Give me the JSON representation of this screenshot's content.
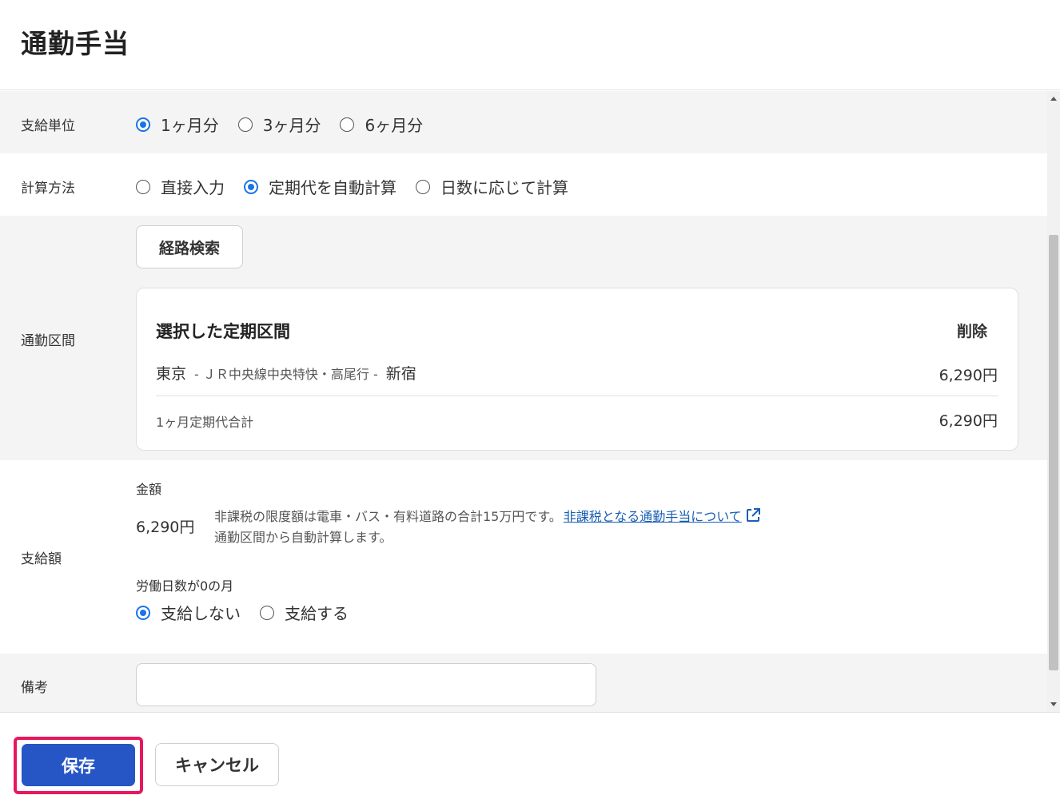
{
  "page": {
    "title": "通勤手当"
  },
  "payment_unit": {
    "label": "支給単位",
    "options": [
      {
        "label": "1ヶ月分",
        "selected": true
      },
      {
        "label": "3ヶ月分",
        "selected": false
      },
      {
        "label": "6ヶ月分",
        "selected": false
      }
    ]
  },
  "calc_method": {
    "label": "計算方法",
    "options": [
      {
        "label": "直接入力",
        "selected": false
      },
      {
        "label": "定期代を自動計算",
        "selected": true
      },
      {
        "label": "日数に応じて計算",
        "selected": false
      }
    ]
  },
  "commute_section": {
    "label": "通勤区間",
    "route_search_button": "経路検索",
    "card": {
      "title": "選択した定期区間",
      "delete_label": "削除",
      "route": {
        "from": "東京",
        "line": "- ＪＲ中央線中央特快・高尾行 -",
        "to": "新宿",
        "price": "6,290円"
      },
      "total_label": "1ヶ月定期代合計",
      "total_value": "6,290円"
    }
  },
  "payment_amount": {
    "label": "支給額",
    "amount_label": "金額",
    "amount_value": "6,290円",
    "note_text": "非課税の限度額は電車・バス・有料道路の合計15万円です。",
    "note_link": "非課税となる通勤手当について",
    "note2": "通勤区間から自動計算します。",
    "zero_days_label": "労働日数が0の月",
    "zero_days_options": [
      {
        "label": "支給しない",
        "selected": true
      },
      {
        "label": "支給する",
        "selected": false
      }
    ]
  },
  "remarks": {
    "label": "備考",
    "value": ""
  },
  "footer": {
    "save_label": "保存",
    "cancel_label": "キャンセル"
  },
  "colors": {
    "accent": "#1a73e8",
    "primary_button": "#2656c6",
    "highlight": "#e8175d",
    "link": "#1a5fb4",
    "row_gray": "#f5f4f4"
  },
  "icons": {
    "external_link": "external-link-icon"
  }
}
